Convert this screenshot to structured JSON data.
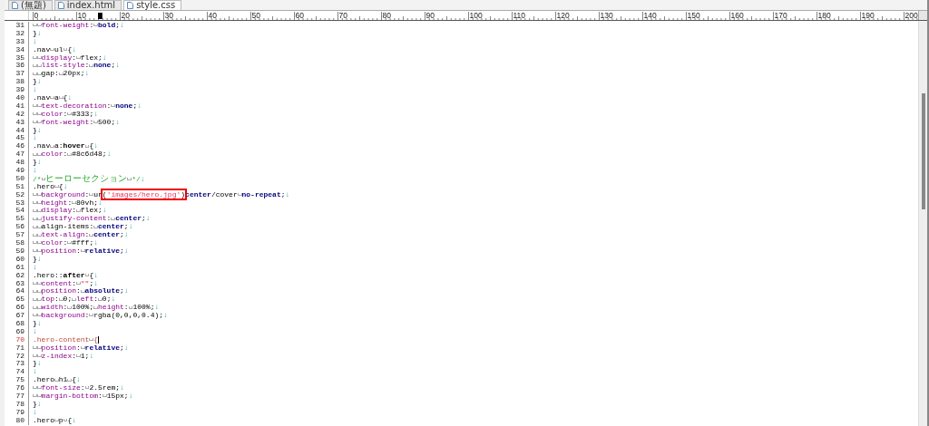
{
  "tabs": [
    {
      "label": "(無題)",
      "selected": false
    },
    {
      "label": "index.html",
      "selected": false
    },
    {
      "label": "style.css",
      "selected": true
    }
  ],
  "ruler": {
    "labels": [
      "0",
      "10",
      "20",
      "30",
      "40",
      "50",
      "60",
      "70",
      "80",
      "90",
      "100",
      "110",
      "120",
      "130",
      "140",
      "150",
      "160",
      "170",
      "180",
      "190",
      "200"
    ]
  },
  "lines": [
    {
      "number": "31",
      "current": false,
      "tokens": [
        {
          "kind": "space"
        },
        {
          "kind": "space"
        },
        {
          "kind": "property",
          "text": "font-weight"
        },
        {
          "kind": "plain",
          "text": ":"
        },
        {
          "kind": "space"
        },
        {
          "kind": "keyword",
          "text": "bold"
        },
        {
          "kind": "plain",
          "text": ";"
        },
        {
          "kind": "eol",
          "text": "↓"
        }
      ]
    },
    {
      "number": "32",
      "current": false,
      "tokens": [
        {
          "kind": "plain",
          "text": "}"
        },
        {
          "kind": "eol",
          "text": "↓"
        }
      ]
    },
    {
      "number": "33",
      "current": false,
      "tokens": [
        {
          "kind": "eol",
          "text": "↓"
        }
      ]
    },
    {
      "number": "34",
      "current": false,
      "tokens": [
        {
          "kind": "plain",
          "text": ".nav"
        },
        {
          "kind": "space"
        },
        {
          "kind": "plain",
          "text": "ul"
        },
        {
          "kind": "space"
        },
        {
          "kind": "plain",
          "text": "{"
        },
        {
          "kind": "eol",
          "text": "↓"
        }
      ]
    },
    {
      "number": "35",
      "current": false,
      "tokens": [
        {
          "kind": "space"
        },
        {
          "kind": "space"
        },
        {
          "kind": "property",
          "text": "display"
        },
        {
          "kind": "plain",
          "text": ":"
        },
        {
          "kind": "space"
        },
        {
          "kind": "plain",
          "text": "flex;"
        },
        {
          "kind": "eol",
          "text": "↓"
        }
      ]
    },
    {
      "number": "36",
      "current": false,
      "tokens": [
        {
          "kind": "space"
        },
        {
          "kind": "space"
        },
        {
          "kind": "property",
          "text": "list-style"
        },
        {
          "kind": "plain",
          "text": ":"
        },
        {
          "kind": "space"
        },
        {
          "kind": "keyword",
          "text": "none"
        },
        {
          "kind": "plain",
          "text": ";"
        },
        {
          "kind": "eol",
          "text": "↓"
        }
      ]
    },
    {
      "number": "37",
      "current": false,
      "tokens": [
        {
          "kind": "space"
        },
        {
          "kind": "space"
        },
        {
          "kind": "plain",
          "text": "gap:"
        },
        {
          "kind": "space"
        },
        {
          "kind": "plain",
          "text": "20px;"
        },
        {
          "kind": "eol",
          "text": "↓"
        }
      ]
    },
    {
      "number": "38",
      "current": false,
      "tokens": [
        {
          "kind": "plain",
          "text": "}"
        },
        {
          "kind": "eol",
          "text": "↓"
        }
      ]
    },
    {
      "number": "39",
      "current": false,
      "tokens": [
        {
          "kind": "eol",
          "text": "↓"
        }
      ]
    },
    {
      "number": "40",
      "current": false,
      "tokens": [
        {
          "kind": "plain",
          "text": ".nav"
        },
        {
          "kind": "space"
        },
        {
          "kind": "plain",
          "text": "a"
        },
        {
          "kind": "space"
        },
        {
          "kind": "plain",
          "text": "{"
        },
        {
          "kind": "eol",
          "text": "↓"
        }
      ]
    },
    {
      "number": "41",
      "current": false,
      "tokens": [
        {
          "kind": "space"
        },
        {
          "kind": "space"
        },
        {
          "kind": "property",
          "text": "text-decoration"
        },
        {
          "kind": "plain",
          "text": ":"
        },
        {
          "kind": "space"
        },
        {
          "kind": "keyword",
          "text": "none"
        },
        {
          "kind": "plain",
          "text": ";"
        },
        {
          "kind": "eol",
          "text": "↓"
        }
      ]
    },
    {
      "number": "42",
      "current": false,
      "tokens": [
        {
          "kind": "space"
        },
        {
          "kind": "space"
        },
        {
          "kind": "property",
          "text": "color"
        },
        {
          "kind": "plain",
          "text": ":"
        },
        {
          "kind": "space"
        },
        {
          "kind": "plain",
          "text": "#333;"
        },
        {
          "kind": "eol",
          "text": "↓"
        }
      ]
    },
    {
      "number": "43",
      "current": false,
      "tokens": [
        {
          "kind": "space"
        },
        {
          "kind": "space"
        },
        {
          "kind": "property",
          "text": "font-weight"
        },
        {
          "kind": "plain",
          "text": ":"
        },
        {
          "kind": "space"
        },
        {
          "kind": "plain",
          "text": "500;"
        },
        {
          "kind": "eol",
          "text": "↓"
        }
      ]
    },
    {
      "number": "44",
      "current": false,
      "tokens": [
        {
          "kind": "plain",
          "text": "}"
        },
        {
          "kind": "eol",
          "text": "↓"
        }
      ]
    },
    {
      "number": "45",
      "current": false,
      "tokens": [
        {
          "kind": "eol",
          "text": "↓"
        }
      ]
    },
    {
      "number": "46",
      "current": false,
      "tokens": [
        {
          "kind": "plain",
          "text": ".nav"
        },
        {
          "kind": "space"
        },
        {
          "kind": "plain",
          "text": "a:"
        },
        {
          "kind": "pseudo",
          "text": "hover"
        },
        {
          "kind": "space"
        },
        {
          "kind": "plain",
          "text": "{"
        },
        {
          "kind": "eol",
          "text": "↓"
        }
      ]
    },
    {
      "number": "47",
      "current": false,
      "tokens": [
        {
          "kind": "space"
        },
        {
          "kind": "space"
        },
        {
          "kind": "property",
          "text": "color"
        },
        {
          "kind": "plain",
          "text": ":"
        },
        {
          "kind": "space"
        },
        {
          "kind": "plain",
          "text": "#8c6d48;"
        },
        {
          "kind": "eol",
          "text": "↓"
        }
      ]
    },
    {
      "number": "48",
      "current": false,
      "tokens": [
        {
          "kind": "plain",
          "text": "}"
        },
        {
          "kind": "eol",
          "text": "↓"
        }
      ]
    },
    {
      "number": "49",
      "current": false,
      "tokens": [
        {
          "kind": "eol",
          "text": "↓"
        }
      ]
    },
    {
      "number": "50",
      "current": false,
      "tokens": [
        {
          "kind": "comment",
          "text": "/*"
        },
        {
          "kind": "space"
        },
        {
          "kind": "comment_wide",
          "text": "ヒーローセクション"
        },
        {
          "kind": "space"
        },
        {
          "kind": "comment",
          "text": "*/"
        },
        {
          "kind": "eol",
          "text": "↓"
        }
      ]
    },
    {
      "number": "51",
      "current": false,
      "tokens": [
        {
          "kind": "plain",
          "text": ".hero"
        },
        {
          "kind": "space"
        },
        {
          "kind": "plain",
          "text": "{"
        },
        {
          "kind": "eol",
          "text": "↓"
        }
      ]
    },
    {
      "number": "52",
      "current": false,
      "tokens": [
        {
          "kind": "space"
        },
        {
          "kind": "space"
        },
        {
          "kind": "property",
          "text": "background"
        },
        {
          "kind": "plain",
          "text": ":"
        },
        {
          "kind": "space"
        },
        {
          "kind": "plain",
          "text": "ur"
        },
        {
          "kind": "plain",
          "text": "(",
          "boxed": true
        },
        {
          "kind": "string",
          "text": "'images/hero.jpg'",
          "boxed": true
        },
        {
          "kind": "plain",
          "text": ")",
          "boxed": true
        },
        {
          "kind": "keyword",
          "text": "center"
        },
        {
          "kind": "plain",
          "text": "/cover"
        },
        {
          "kind": "space"
        },
        {
          "kind": "keyword",
          "text": "no-repeat"
        },
        {
          "kind": "plain",
          "text": ";"
        },
        {
          "kind": "eol",
          "text": "↓"
        }
      ]
    },
    {
      "number": "53",
      "current": false,
      "tokens": [
        {
          "kind": "space"
        },
        {
          "kind": "space"
        },
        {
          "kind": "property",
          "text": "height"
        },
        {
          "kind": "plain",
          "text": ":"
        },
        {
          "kind": "space"
        },
        {
          "kind": "plain",
          "text": "80vh;"
        },
        {
          "kind": "eol",
          "text": "↓"
        }
      ]
    },
    {
      "number": "54",
      "current": false,
      "tokens": [
        {
          "kind": "space"
        },
        {
          "kind": "space"
        },
        {
          "kind": "property",
          "text": "display"
        },
        {
          "kind": "plain",
          "text": ":"
        },
        {
          "kind": "space"
        },
        {
          "kind": "plain",
          "text": "flex;"
        },
        {
          "kind": "eol",
          "text": "↓"
        }
      ]
    },
    {
      "number": "55",
      "current": false,
      "tokens": [
        {
          "kind": "space"
        },
        {
          "kind": "space"
        },
        {
          "kind": "property",
          "text": "justify-content"
        },
        {
          "kind": "plain",
          "text": ":"
        },
        {
          "kind": "space"
        },
        {
          "kind": "keyword",
          "text": "center"
        },
        {
          "kind": "plain",
          "text": ";"
        },
        {
          "kind": "eol",
          "text": "↓"
        }
      ]
    },
    {
      "number": "56",
      "current": false,
      "tokens": [
        {
          "kind": "space"
        },
        {
          "kind": "space"
        },
        {
          "kind": "plain",
          "text": "align-items:"
        },
        {
          "kind": "space"
        },
        {
          "kind": "keyword",
          "text": "center"
        },
        {
          "kind": "plain",
          "text": ";"
        },
        {
          "kind": "eol",
          "text": "↓"
        }
      ]
    },
    {
      "number": "57",
      "current": false,
      "tokens": [
        {
          "kind": "space"
        },
        {
          "kind": "space"
        },
        {
          "kind": "property",
          "text": "text-align"
        },
        {
          "kind": "plain",
          "text": ":"
        },
        {
          "kind": "space"
        },
        {
          "kind": "keyword",
          "text": "center"
        },
        {
          "kind": "plain",
          "text": ";"
        },
        {
          "kind": "eol",
          "text": "↓"
        }
      ]
    },
    {
      "number": "58",
      "current": false,
      "tokens": [
        {
          "kind": "space"
        },
        {
          "kind": "space"
        },
        {
          "kind": "property",
          "text": "color"
        },
        {
          "kind": "plain",
          "text": ":"
        },
        {
          "kind": "space"
        },
        {
          "kind": "plain",
          "text": "#fff;"
        },
        {
          "kind": "eol",
          "text": "↓"
        }
      ]
    },
    {
      "number": "59",
      "current": false,
      "tokens": [
        {
          "kind": "space"
        },
        {
          "kind": "space"
        },
        {
          "kind": "property",
          "text": "position"
        },
        {
          "kind": "plain",
          "text": ":"
        },
        {
          "kind": "space"
        },
        {
          "kind": "keyword",
          "text": "relative"
        },
        {
          "kind": "plain",
          "text": ";"
        },
        {
          "kind": "eol",
          "text": "↓"
        }
      ]
    },
    {
      "number": "60",
      "current": false,
      "tokens": [
        {
          "kind": "plain",
          "text": "}"
        },
        {
          "kind": "eol",
          "text": "↓"
        }
      ]
    },
    {
      "number": "61",
      "current": false,
      "tokens": [
        {
          "kind": "eol",
          "text": "↓"
        }
      ]
    },
    {
      "number": "62",
      "current": false,
      "tokens": [
        {
          "kind": "plain",
          "text": ".hero::"
        },
        {
          "kind": "pseudo",
          "text": "after"
        },
        {
          "kind": "space"
        },
        {
          "kind": "plain",
          "text": "{"
        },
        {
          "kind": "eol",
          "text": "↓"
        }
      ]
    },
    {
      "number": "63",
      "current": false,
      "tokens": [
        {
          "kind": "space"
        },
        {
          "kind": "space"
        },
        {
          "kind": "property",
          "text": "content"
        },
        {
          "kind": "plain",
          "text": ":"
        },
        {
          "kind": "space"
        },
        {
          "kind": "string",
          "text": "\"\""
        },
        {
          "kind": "plain",
          "text": ";"
        },
        {
          "kind": "eol",
          "text": "↓"
        }
      ]
    },
    {
      "number": "64",
      "current": false,
      "tokens": [
        {
          "kind": "space"
        },
        {
          "kind": "space"
        },
        {
          "kind": "property",
          "text": "position"
        },
        {
          "kind": "plain",
          "text": ":"
        },
        {
          "kind": "space"
        },
        {
          "kind": "keyword",
          "text": "absolute"
        },
        {
          "kind": "plain",
          "text": ";"
        },
        {
          "kind": "eol",
          "text": "↓"
        }
      ]
    },
    {
      "number": "65",
      "current": false,
      "tokens": [
        {
          "kind": "space"
        },
        {
          "kind": "space"
        },
        {
          "kind": "property",
          "text": "top"
        },
        {
          "kind": "plain",
          "text": ":"
        },
        {
          "kind": "space"
        },
        {
          "kind": "plain",
          "text": "0;"
        },
        {
          "kind": "space"
        },
        {
          "kind": "property",
          "text": "left"
        },
        {
          "kind": "plain",
          "text": ":"
        },
        {
          "kind": "space"
        },
        {
          "kind": "plain",
          "text": "0;"
        },
        {
          "kind": "eol",
          "text": "↓"
        }
      ]
    },
    {
      "number": "66",
      "current": false,
      "tokens": [
        {
          "kind": "space"
        },
        {
          "kind": "space"
        },
        {
          "kind": "property",
          "text": "width"
        },
        {
          "kind": "plain",
          "text": ":"
        },
        {
          "kind": "space"
        },
        {
          "kind": "plain",
          "text": "100%;"
        },
        {
          "kind": "space"
        },
        {
          "kind": "property",
          "text": "height"
        },
        {
          "kind": "plain",
          "text": ":"
        },
        {
          "kind": "space"
        },
        {
          "kind": "plain",
          "text": "100%;"
        },
        {
          "kind": "eol",
          "text": "↓"
        }
      ]
    },
    {
      "number": "67",
      "current": false,
      "tokens": [
        {
          "kind": "space"
        },
        {
          "kind": "space"
        },
        {
          "kind": "property",
          "text": "background"
        },
        {
          "kind": "plain",
          "text": ":"
        },
        {
          "kind": "space"
        },
        {
          "kind": "plain",
          "text": "rgba(0,0,0,0.4);"
        },
        {
          "kind": "eol",
          "text": "↓"
        }
      ]
    },
    {
      "number": "68",
      "current": false,
      "tokens": [
        {
          "kind": "plain",
          "text": "}"
        },
        {
          "kind": "eol",
          "text": "↓"
        }
      ]
    },
    {
      "number": "69",
      "current": false,
      "tokens": [
        {
          "kind": "eol",
          "text": "↓"
        }
      ]
    },
    {
      "number": "70",
      "current": true,
      "tokens": [
        {
          "kind": "plain",
          "text": ".hero-content"
        },
        {
          "kind": "space"
        },
        {
          "kind": "plain",
          "text": "{"
        },
        {
          "kind": "cursor"
        }
      ]
    },
    {
      "number": "71",
      "current": false,
      "tokens": [
        {
          "kind": "space"
        },
        {
          "kind": "space"
        },
        {
          "kind": "property",
          "text": "position"
        },
        {
          "kind": "plain",
          "text": ":"
        },
        {
          "kind": "space"
        },
        {
          "kind": "keyword",
          "text": "relative"
        },
        {
          "kind": "plain",
          "text": ";"
        },
        {
          "kind": "eol",
          "text": "↓"
        }
      ]
    },
    {
      "number": "72",
      "current": false,
      "tokens": [
        {
          "kind": "space"
        },
        {
          "kind": "space"
        },
        {
          "kind": "property",
          "text": "z-index"
        },
        {
          "kind": "plain",
          "text": ":"
        },
        {
          "kind": "space"
        },
        {
          "kind": "plain",
          "text": "1;"
        },
        {
          "kind": "eol",
          "text": "↓"
        }
      ]
    },
    {
      "number": "73",
      "current": false,
      "tokens": [
        {
          "kind": "plain",
          "text": "}"
        },
        {
          "kind": "eol",
          "text": "↓"
        }
      ]
    },
    {
      "number": "74",
      "current": false,
      "tokens": [
        {
          "kind": "eol",
          "text": "↓"
        }
      ]
    },
    {
      "number": "75",
      "current": false,
      "tokens": [
        {
          "kind": "plain",
          "text": ".hero"
        },
        {
          "kind": "space"
        },
        {
          "kind": "plain",
          "text": "h1"
        },
        {
          "kind": "space"
        },
        {
          "kind": "plain",
          "text": "{"
        },
        {
          "kind": "eol",
          "text": "↓"
        }
      ]
    },
    {
      "number": "76",
      "current": false,
      "tokens": [
        {
          "kind": "space"
        },
        {
          "kind": "space"
        },
        {
          "kind": "property",
          "text": "font-size"
        },
        {
          "kind": "plain",
          "text": ":"
        },
        {
          "kind": "space"
        },
        {
          "kind": "plain",
          "text": "2.5rem;"
        },
        {
          "kind": "eol",
          "text": "↓"
        }
      ]
    },
    {
      "number": "77",
      "current": false,
      "tokens": [
        {
          "kind": "space"
        },
        {
          "kind": "space"
        },
        {
          "kind": "property",
          "text": "margin-bottom"
        },
        {
          "kind": "plain",
          "text": ":"
        },
        {
          "kind": "space"
        },
        {
          "kind": "plain",
          "text": "15px;"
        },
        {
          "kind": "eol",
          "text": "↓"
        }
      ]
    },
    {
      "number": "78",
      "current": false,
      "tokens": [
        {
          "kind": "plain",
          "text": "}"
        },
        {
          "kind": "eol",
          "text": "↓"
        }
      ]
    },
    {
      "number": "79",
      "current": false,
      "tokens": [
        {
          "kind": "eol",
          "text": "↓"
        }
      ]
    },
    {
      "number": "80",
      "current": false,
      "tokens": [
        {
          "kind": "plain",
          "text": ".hero"
        },
        {
          "kind": "space"
        },
        {
          "kind": "plain",
          "text": "p"
        },
        {
          "kind": "space"
        },
        {
          "kind": "plain",
          "text": "{"
        },
        {
          "kind": "eol",
          "text": "↓"
        }
      ]
    }
  ]
}
